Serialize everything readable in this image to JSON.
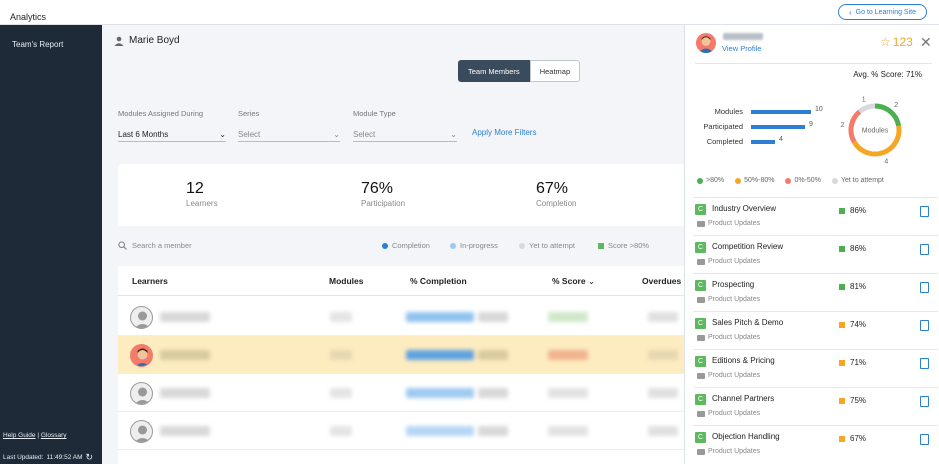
{
  "app": {
    "title": "Analytics",
    "goto_label": "Go to Learning Site"
  },
  "sidebar": {
    "items": [
      {
        "label": "Team's Report"
      }
    ],
    "help": "Help Guide",
    "glossary": "Glossary",
    "last_updated_label": "Last Updated:",
    "last_updated_time": "11:49:52 AM"
  },
  "main": {
    "user_name": "Marie Boyd",
    "tabs": [
      {
        "label": "Team Members",
        "active": true
      },
      {
        "label": "Heatmap",
        "active": false
      }
    ],
    "filters": [
      {
        "label": "Modules Assigned During",
        "value": "Last 6 Months"
      },
      {
        "label": "Series",
        "value": "Select"
      },
      {
        "label": "Module Type",
        "value": "Select"
      }
    ],
    "apply_filters": "Apply More Filters",
    "stats": [
      {
        "value": "12",
        "label": "Learners"
      },
      {
        "value": "76%",
        "label": "Participation"
      },
      {
        "value": "67%",
        "label": "Completion"
      }
    ],
    "search_placeholder": "Search a member",
    "legend": [
      {
        "label": "Completion",
        "color": "#2d7fd3"
      },
      {
        "label": "In-progress",
        "color": "#9ec9f2"
      },
      {
        "label": "Yet to attempt",
        "color": "#d6d9dd"
      },
      {
        "label": "Score >80%",
        "color": "#5eb85e"
      }
    ],
    "table_headers": [
      "Learners",
      "Modules",
      "% Completion",
      "% Score",
      "Overdues"
    ]
  },
  "panel": {
    "view_profile": "View Profile",
    "points": "123",
    "avg_score": "Avg. % Score: 71%",
    "bars": [
      {
        "label": "Modules",
        "value": 10
      },
      {
        "label": "Participated",
        "value": 9
      },
      {
        "label": "Completed",
        "value": 4
      }
    ],
    "donut": {
      "center": "Modules",
      "segments": [
        {
          "value": 2,
          "color": "#4caf50",
          "label": ">80%"
        },
        {
          "value": 4,
          "color": "#f5a623",
          "label": "50%-80%"
        },
        {
          "value": 2,
          "color": "#f47b6a",
          "label": "0%-50%"
        },
        {
          "value": 1,
          "color": "#d6d9dd",
          "label": "Yet to attempt"
        }
      ]
    },
    "legend": [
      ">80%",
      "50%-80%",
      "0%-50%",
      "Yet to attempt"
    ],
    "modules": [
      {
        "badge": "C",
        "name": "Industry Overview",
        "category": "Product Updates",
        "score": "86%",
        "color": "#4caf50"
      },
      {
        "badge": "C",
        "name": "Competition Review",
        "category": "Product Updates",
        "score": "86%",
        "color": "#4caf50"
      },
      {
        "badge": "C",
        "name": "Prospecting",
        "category": "Product Updates",
        "score": "81%",
        "color": "#4caf50"
      },
      {
        "badge": "C",
        "name": "Sales Pitch & Demo",
        "category": "Product Updates",
        "score": "74%",
        "color": "#f5a623"
      },
      {
        "badge": "C",
        "name": "Editions & Pricing",
        "category": "Product Updates",
        "score": "71%",
        "color": "#f5a623"
      },
      {
        "badge": "C",
        "name": "Channel Partners",
        "category": "Product Updates",
        "score": "75%",
        "color": "#f5a623"
      },
      {
        "badge": "C",
        "name": "Objection Handling",
        "category": "Product Updates",
        "score": "67%",
        "color": "#f5a623"
      }
    ]
  }
}
